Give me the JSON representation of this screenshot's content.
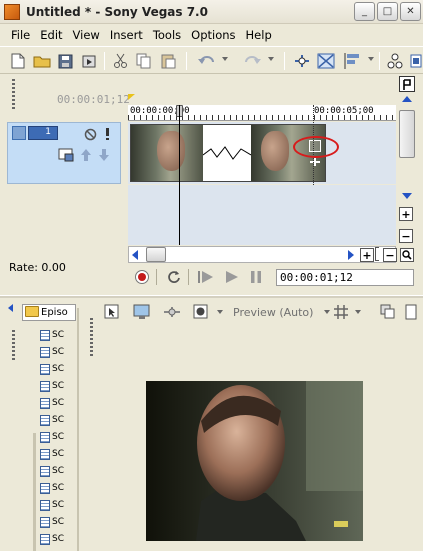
{
  "window": {
    "title": "Untitled * - Sony Vegas 7.0",
    "controls": {
      "minimize": "_",
      "maximize": "□",
      "close": "✕"
    }
  },
  "menu": {
    "items": [
      {
        "label": "File"
      },
      {
        "label": "Edit"
      },
      {
        "label": "View"
      },
      {
        "label": "Insert"
      },
      {
        "label": "Tools"
      },
      {
        "label": "Options"
      },
      {
        "label": "Help"
      }
    ]
  },
  "timeline": {
    "cursor_time": "00:00:01;12",
    "ruler_start": "00:00:00;00",
    "ruler_mark": "00:00:05;00",
    "track_number": "1",
    "rate_label": "Rate: 0.00",
    "timecode_readout": "00:00:01;12"
  },
  "explorer": {
    "folder_label": "Episo",
    "file_label": "SC",
    "file_count": 13
  },
  "preview": {
    "mode_label": "Preview (Auto)"
  },
  "colors": {
    "track_header": "#C4DDF6",
    "highlight_circle": "#D81B1B",
    "record_button": "#C41A1A"
  }
}
